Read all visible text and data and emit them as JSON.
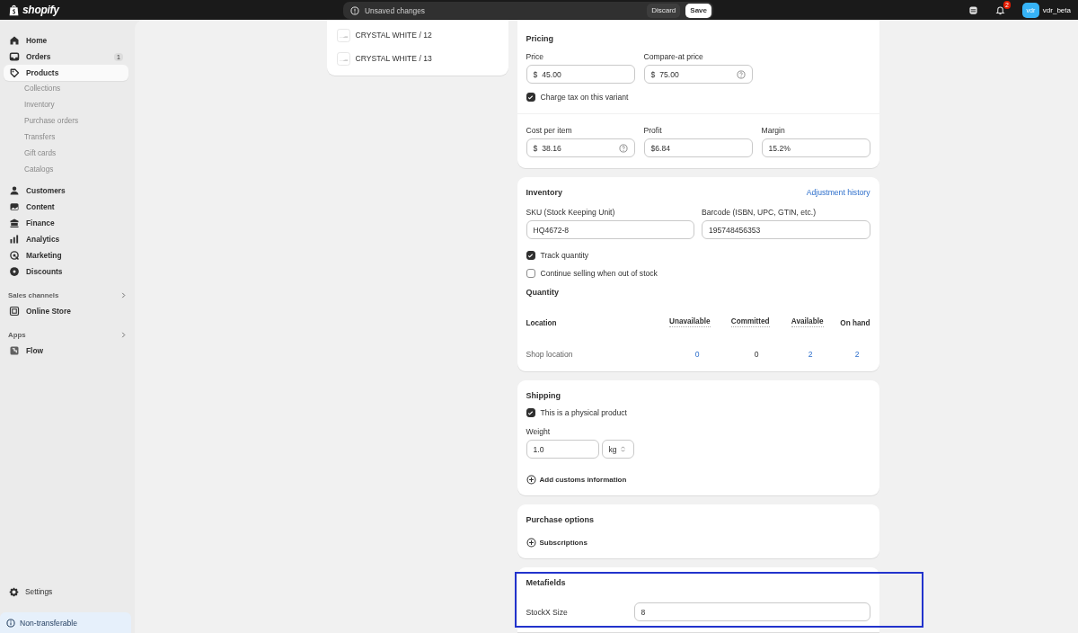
{
  "topbar": {
    "logo": "shopify",
    "notice": "Unsaved changes",
    "discard": "Discard",
    "save": "Save",
    "notification_count": "2",
    "avatar_initials": "vdr",
    "user": "vdr_beta"
  },
  "sidebar": {
    "items": [
      {
        "label": "Home",
        "selected": false
      },
      {
        "label": "Orders",
        "badge": "1",
        "selected": false
      },
      {
        "label": "Products",
        "selected": true,
        "children": [
          {
            "label": "Collections",
            "selected": false
          },
          {
            "label": "Inventory",
            "selected": false
          },
          {
            "label": "Purchase orders",
            "selected": false
          },
          {
            "label": "Transfers",
            "selected": false
          },
          {
            "label": "Gift cards",
            "selected": false
          },
          {
            "label": "Catalogs",
            "selected": false
          }
        ]
      },
      {
        "label": "Customers",
        "selected": false
      },
      {
        "label": "Content",
        "selected": false
      },
      {
        "label": "Finance",
        "selected": false
      },
      {
        "label": "Analytics",
        "selected": false
      },
      {
        "label": "Marketing",
        "selected": false
      },
      {
        "label": "Discounts",
        "selected": false
      }
    ],
    "sections": [
      {
        "title": "Sales channels",
        "items": [
          {
            "label": "Online Store",
            "selected": false
          }
        ]
      },
      {
        "title": "Apps",
        "items": [
          {
            "label": "Flow",
            "selected": false
          }
        ]
      }
    ],
    "settings": "Settings",
    "footer_notice": "Non-transferable"
  },
  "variants": [
    "CRYSTAL WHITE / 12",
    "CRYSTAL WHITE / 13"
  ],
  "pricing": {
    "title": "Pricing",
    "row_1": [
      {
        "label": "Price",
        "prefix": "$",
        "value": "45.00",
        "help": false
      },
      {
        "label": "Compare-at price",
        "prefix": "$",
        "value": "75.00",
        "help": true
      }
    ],
    "charge_tax": {
      "label": "Charge tax on this variant",
      "checked": true
    },
    "row_2": [
      {
        "label": "Cost per item",
        "prefix": "$",
        "value": "38.16",
        "help": true
      },
      {
        "label": "Profit",
        "value": "$6.84",
        "help": false
      },
      {
        "label": "Margin",
        "value": "15.2%",
        "help": false
      }
    ]
  },
  "inventory": {
    "title": "Inventory",
    "link": "Adjustment history",
    "fields": [
      {
        "label": "SKU (Stock Keeping Unit)",
        "value": "HQ4672-8"
      },
      {
        "label": "Barcode (ISBN, UPC, GTIN, etc.)",
        "value": "195748456353"
      }
    ],
    "checkboxes": [
      {
        "label": "Track quantity",
        "checked": true
      },
      {
        "label": "Continue selling when out of stock",
        "checked": false
      }
    ],
    "quantity_title": "Quantity",
    "columns": [
      {
        "label": "Location",
        "dotted": false
      },
      {
        "label": "Unavailable",
        "dotted": true
      },
      {
        "label": "Committed",
        "dotted": true
      },
      {
        "label": "Available",
        "dotted": true
      },
      {
        "label": "On hand",
        "dotted": false
      }
    ],
    "rows": [
      {
        "cells": [
          {
            "text": "Shop location",
            "link": false
          },
          {
            "text": "0",
            "link": true
          },
          {
            "text": "0",
            "link": false
          },
          {
            "text": "2",
            "link": true
          },
          {
            "text": "2",
            "link": true
          }
        ]
      }
    ]
  },
  "shipping": {
    "title": "Shipping",
    "physical": {
      "label": "This is a physical product",
      "checked": true
    },
    "weight_label": "Weight",
    "weight_value": "1.0",
    "unit": "kg",
    "action": "Add customs information"
  },
  "purchase_options": {
    "title": "Purchase options",
    "action": "Subscriptions"
  },
  "metafields": {
    "title": "Metafields",
    "fields": [
      {
        "label": "StockX Size",
        "value": "8"
      }
    ]
  }
}
